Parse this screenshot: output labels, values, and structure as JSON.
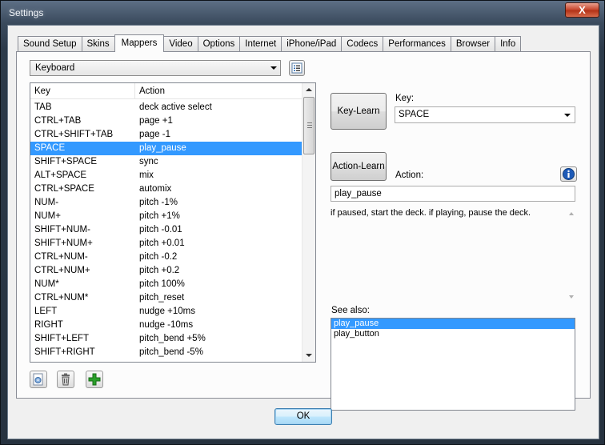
{
  "window": {
    "title": "Settings",
    "close_label": "X"
  },
  "tabs": [
    {
      "label": "Sound Setup"
    },
    {
      "label": "Skins"
    },
    {
      "label": "Mappers",
      "active": true
    },
    {
      "label": "Video"
    },
    {
      "label": "Options"
    },
    {
      "label": "Internet"
    },
    {
      "label": "iPhone/iPad"
    },
    {
      "label": "Codecs"
    },
    {
      "label": "Performances"
    },
    {
      "label": "Browser"
    },
    {
      "label": "Info"
    }
  ],
  "mapper": {
    "device": "Keyboard",
    "columns": {
      "key": "Key",
      "action": "Action"
    },
    "rows": [
      {
        "key": "TAB",
        "action": "deck active select"
      },
      {
        "key": "CTRL+TAB",
        "action": "page +1"
      },
      {
        "key": "CTRL+SHIFT+TAB",
        "action": "page -1"
      },
      {
        "key": "SPACE",
        "action": "play_pause",
        "selected": true
      },
      {
        "key": "SHIFT+SPACE",
        "action": "sync"
      },
      {
        "key": "ALT+SPACE",
        "action": "mix"
      },
      {
        "key": "CTRL+SPACE",
        "action": "automix"
      },
      {
        "key": "NUM-",
        "action": "pitch -1%"
      },
      {
        "key": "NUM+",
        "action": "pitch +1%"
      },
      {
        "key": "SHIFT+NUM-",
        "action": "pitch -0.01"
      },
      {
        "key": "SHIFT+NUM+",
        "action": "pitch +0.01"
      },
      {
        "key": "CTRL+NUM-",
        "action": "pitch -0.2"
      },
      {
        "key": "CTRL+NUM+",
        "action": "pitch +0.2"
      },
      {
        "key": "NUM*",
        "action": "pitch 100%"
      },
      {
        "key": "CTRL+NUM*",
        "action": "pitch_reset"
      },
      {
        "key": "LEFT",
        "action": "nudge +10ms"
      },
      {
        "key": "RIGHT",
        "action": "nudge -10ms"
      },
      {
        "key": "SHIFT+LEFT",
        "action": "pitch_bend +5%"
      },
      {
        "key": "SHIFT+RIGHT",
        "action": "pitch_bend -5%"
      }
    ]
  },
  "detail": {
    "key_learn_label": "Key-Learn",
    "key_label": "Key:",
    "key_value": "SPACE",
    "action_learn_label": "Action-Learn",
    "action_label": "Action:",
    "action_value": "play_pause",
    "description": "if paused, start the deck. if playing, pause the deck.",
    "see_also_label": "See also:",
    "see_also": [
      {
        "label": "play_pause",
        "selected": true
      },
      {
        "label": "play_button"
      }
    ]
  },
  "footer": {
    "ok_label": "OK"
  },
  "icons": [
    "close-icon",
    "list-view-icon",
    "info-icon",
    "import-icon",
    "trash-icon",
    "add-icon"
  ],
  "colors": {
    "selection": "#3399ff",
    "add_green": "#2aa02a",
    "info_blue": "#1e5bb8"
  }
}
